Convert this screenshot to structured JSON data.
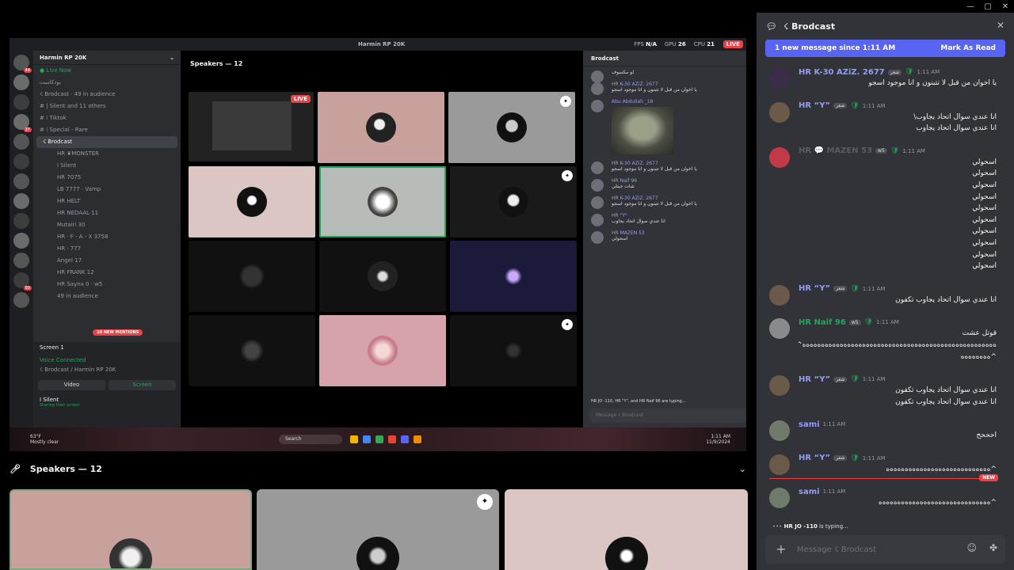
{
  "window": {
    "minimize": "—",
    "maximize": "▢",
    "close": "✕"
  },
  "stream": {
    "title": "Harmin RP 20K",
    "stats": {
      "fps_label": "FPS",
      "fps": "N/A",
      "gpu_label": "GPU",
      "gpu": "26",
      "cpu_label": "CPU",
      "cpu": "21"
    },
    "live": "LIVE",
    "server_name": "Harmin RP 20K",
    "channels": [
      {
        "text": "● Live Now",
        "cls": "g"
      },
      {
        "text": "بودكاست",
        "cls": ""
      },
      {
        "text": "☇ Brodcast · 49 in audience",
        "cls": ""
      },
      {
        "text": "# | Silent and 11 others",
        "cls": ""
      },
      {
        "text": "# ⁞ Tiktok",
        "cls": ""
      },
      {
        "text": "# ⁞ Special - Rare",
        "cls": ""
      },
      {
        "text": "☇ Brodcast",
        "cls": "hl"
      }
    ],
    "members": [
      "HR ❦MONSTER",
      "I Silent",
      "HR 7075",
      "LB 7777 · Vamp",
      "HR HELT",
      "HR NEDAAL 11",
      "Mutairi 30",
      "HR · F - A - X 3758",
      "HR · 777",
      "Angel 17",
      "HR FRANK 12",
      "HR Saynx 0 · w5",
      "49 in audience"
    ],
    "new_mentions": "10 NEW MENTIONS",
    "screen_label": "Screen 1",
    "voice_connected": "Voice Connected",
    "voice_location": "☇ Brodcast / Harmin RP 20K",
    "video_btn": "Video",
    "screen_btn": "Screen",
    "me_name": "I Silent",
    "me_status": "Sharing their screen",
    "speakers": "Speakers — 12",
    "chat_title": "Brodcast",
    "chat_messages": [
      {
        "name": "",
        "text": "لو مكسوف"
      },
      {
        "name": "HR K-30 AZiZ. 2677",
        "text": "يا اخوان من قبل لا تتبنون و انا موجود اسجو"
      },
      {
        "name": "Abu Abdullah _18",
        "text": ""
      },
      {
        "name": "HR K-30 AZiZ. 2677",
        "text": "يا اخوان من قبل لا تتبنون و انا موجود اسجو"
      },
      {
        "name": "HR Naif 96",
        "text": "شات جيتلي"
      },
      {
        "name": "HR K-30 AZiZ. 2677",
        "text": "يا اخوان من قبل لا تتبنون و انا موجود اسجو"
      },
      {
        "name": "HR \"Y\"",
        "text": "انا عندي سوال اتحاد يجاوب"
      },
      {
        "name": "HR MAZEN 53",
        "text": "اسحولي"
      }
    ],
    "typing": "HR JO -110, HR \"Y\", and HR Naif 96 are typing...",
    "chat_placeholder": "Message ☇ Brodcast",
    "taskbar_weather": "63°F",
    "taskbar_weather2": "Mostly clear",
    "taskbar_search": "Search",
    "taskbar_time": "1:11 AM",
    "taskbar_date": "11/9/2024"
  },
  "speakers_header": "Speakers — 12",
  "chat": {
    "channel": "☇ Brodcast",
    "new_banner": "1 new message since 1:11 AM",
    "mark_read": "Mark As Read",
    "new_label": "NEW",
    "typing_user": "HR JO -110",
    "typing_suffix": " is typing...",
    "placeholder": "Message ☇ Brodcast",
    "messages": [
      {
        "name": "HR K-30 AZiZ. 2677",
        "color": "#949cf7",
        "tag": "شعر",
        "time": "1:11 AM",
        "lines": [
          "يا اخوان من قبل لا تتبنون و انا موجود اسجو"
        ]
      },
      {
        "name": "HR “Y”",
        "color": "#949cf7",
        "tag": "شعر",
        "time": "1:11 AM",
        "lines": [
          "انا عندي سوال اتحاد يجاوب\\",
          "انا عندي سوال اتحاد يجاوب"
        ]
      },
      {
        "name": "HR 💬 MAZEN 53",
        "color": "#5a5d63",
        "tag": "w5",
        "time": "1:11 AM",
        "lines": [
          "اسحولي",
          "اسحولي",
          "اسحولي",
          "اسحولي",
          "اسحولي",
          "اسحولي",
          "اسحولي",
          "اسحولي",
          "اسحولي",
          "اسحولي"
        ]
      },
      {
        "name": "HR “Y”",
        "color": "#949cf7",
        "tag": "شعر",
        "time": "1:11 AM",
        "lines": [
          "انا عندي سوال اتحاد يجاوب تكفون"
        ]
      },
      {
        "name": "HR Naif 96",
        "color": "#23a559",
        "tag": "w5",
        "time": "1:11 AM",
        "lines": [
          "قوتل عشت",
          "ەەەەەەەەەەەەەەەەەەەەەەەەەەەەەەەەەەەەەەەەەەەەەەەەەەەە^",
          "^ەەەەەەەە"
        ]
      },
      {
        "name": "HR “Y”",
        "color": "#949cf7",
        "tag": "شعر",
        "time": "1:11 AM",
        "lines": [
          "انا عندي سوال اتحاد يجاوب تكفون",
          "انا عندي سوال اتحاد يجاوب تكفون"
        ]
      },
      {
        "name": "sami",
        "color": "#949cf7",
        "tag": "",
        "time": "1:11 AM",
        "lines": [
          "احححح"
        ]
      },
      {
        "name": "HR “Y”",
        "color": "#949cf7",
        "tag": "شعر",
        "time": "1:11 AM",
        "lines": [
          "^ەەەەەەەەەەەەەەەەەەەەەەەەەەەە"
        ]
      },
      {
        "name": "sami",
        "color": "#949cf7",
        "tag": "",
        "time": "1:11 AM",
        "lines": [
          "^ەەەەەەەەەەەەەەەەەەەەەەەەەەەەەە"
        ]
      }
    ]
  }
}
